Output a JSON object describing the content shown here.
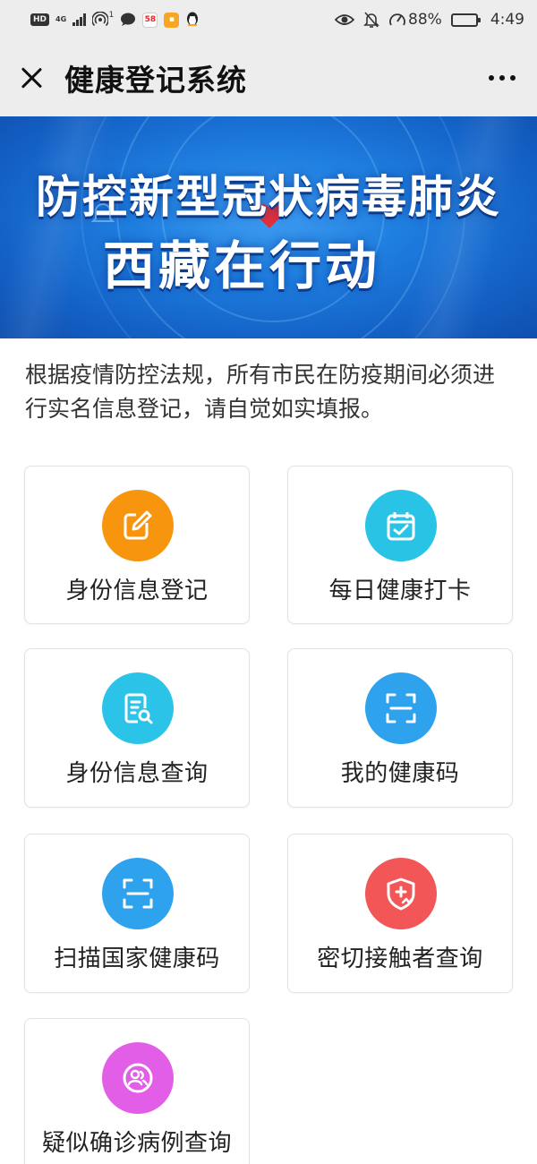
{
  "status_bar": {
    "network_badge": "HD",
    "network_type": "4G",
    "notification_count": "1",
    "app_badge_label": "58",
    "battery_percent": "88%",
    "battery_level": 0.88,
    "time": "4:49"
  },
  "nav": {
    "title": "健康登记系统"
  },
  "banner": {
    "line1": "防控新型冠状病毒肺炎",
    "line2": "西藏在行动"
  },
  "intro": "根据疫情防控法规，所有市民在防疫期间必须进行实名信息登记，请自觉如实填报。",
  "tiles": [
    {
      "label": "身份信息登记",
      "icon": "edit-icon",
      "color": "#f7950f"
    },
    {
      "label": "每日健康打卡",
      "icon": "calendar-check-icon",
      "color": "#29c3e6"
    },
    {
      "label": "身份信息查询",
      "icon": "document-search-icon",
      "color": "#2bc4e8"
    },
    {
      "label": "我的健康码",
      "icon": "scan-code-icon",
      "color": "#2fa2ee"
    },
    {
      "label": "扫描国家健康码",
      "icon": "scan-code-icon",
      "color": "#2fa2ee"
    },
    {
      "label": "密切接触者查询",
      "icon": "shield-medical-icon",
      "color": "#f25656"
    },
    {
      "label": "疑似确诊病例查询",
      "icon": "users-circle-icon",
      "color": "#e25ee6"
    }
  ]
}
